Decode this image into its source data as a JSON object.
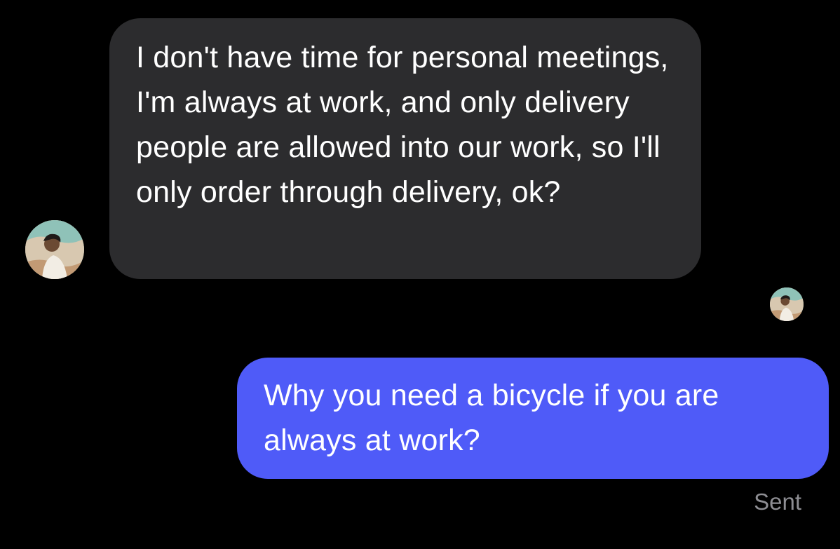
{
  "thread": {
    "received_message": {
      "text": "I don't have time for personal meetings, I'm always at work, and only delivery people are allowed into our work, so I'll only order through delivery, ok?"
    },
    "sent_message": {
      "text": "Why you need a bicycle if you are always at work?",
      "status": "Sent"
    }
  },
  "colors": {
    "background": "#000000",
    "received_bubble": "#2c2c2e",
    "sent_bubble": "#4f5bf8",
    "status_text": "#8e8e93"
  }
}
